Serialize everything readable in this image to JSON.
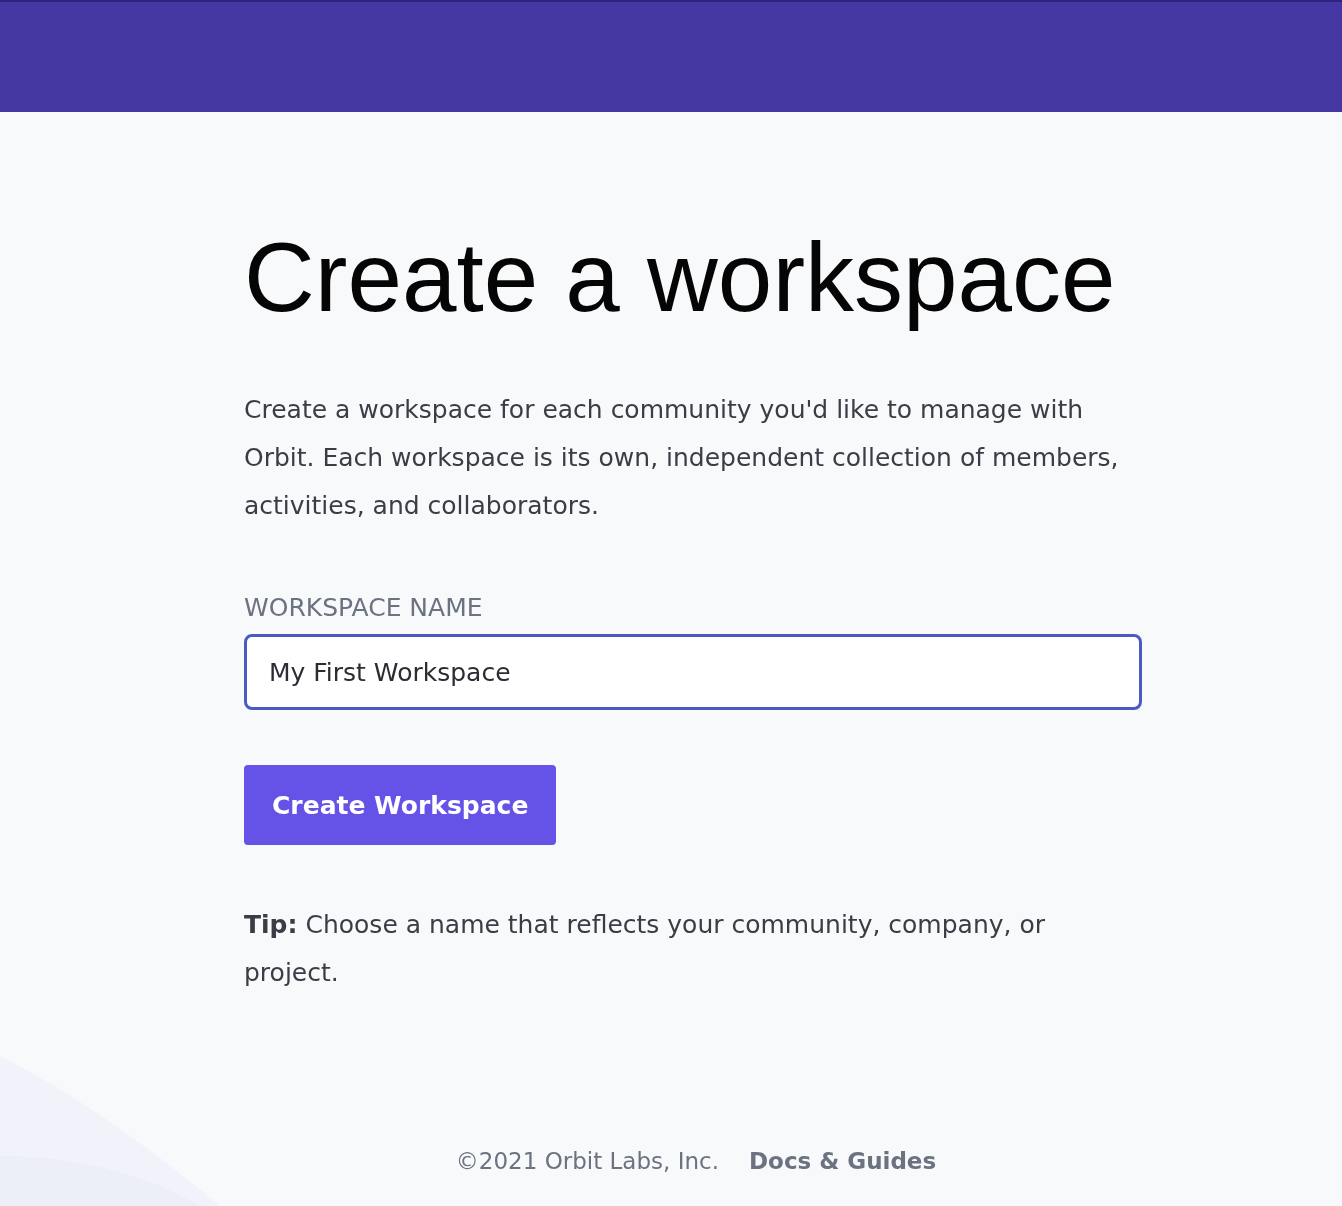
{
  "heading": "Create a workspace",
  "intro": "Create a workspace for each community you'd like to manage with Orbit. Each workspace is its own, independent collection of members, activities, and collaborators.",
  "field": {
    "label": "WORKSPACE NAME",
    "value": "My First Workspace",
    "focused": true
  },
  "button": "Create Workspace",
  "tip": "**Tip:** Choose a name that reflects your community, company, or project.",
  "footer": {
    "copyright": "©2021 Orbit Labs, Inc.",
    "link": "Docs & Guides"
  }
}
